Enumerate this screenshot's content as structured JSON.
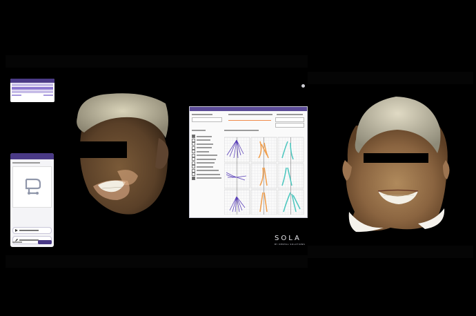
{
  "branding": {
    "logo": "SOLA",
    "logo_sub": "BY DENTAL SOLUTIONS"
  },
  "colors": {
    "panel_header": "#4a3a86",
    "panel_highlight": "#8c77d0",
    "trace_purple": "#5a40b8",
    "trace_orange": "#f0a050",
    "trace_teal": "#50c8c0",
    "slider": "#f08a4a"
  },
  "icons": {
    "tool_icon": "articulator-icon",
    "status_dot": "dot-icon"
  },
  "analysis_dialog": {
    "checkbox_states": [
      true,
      false,
      false,
      false,
      false,
      false,
      false,
      false,
      false,
      false,
      false,
      true
    ]
  }
}
